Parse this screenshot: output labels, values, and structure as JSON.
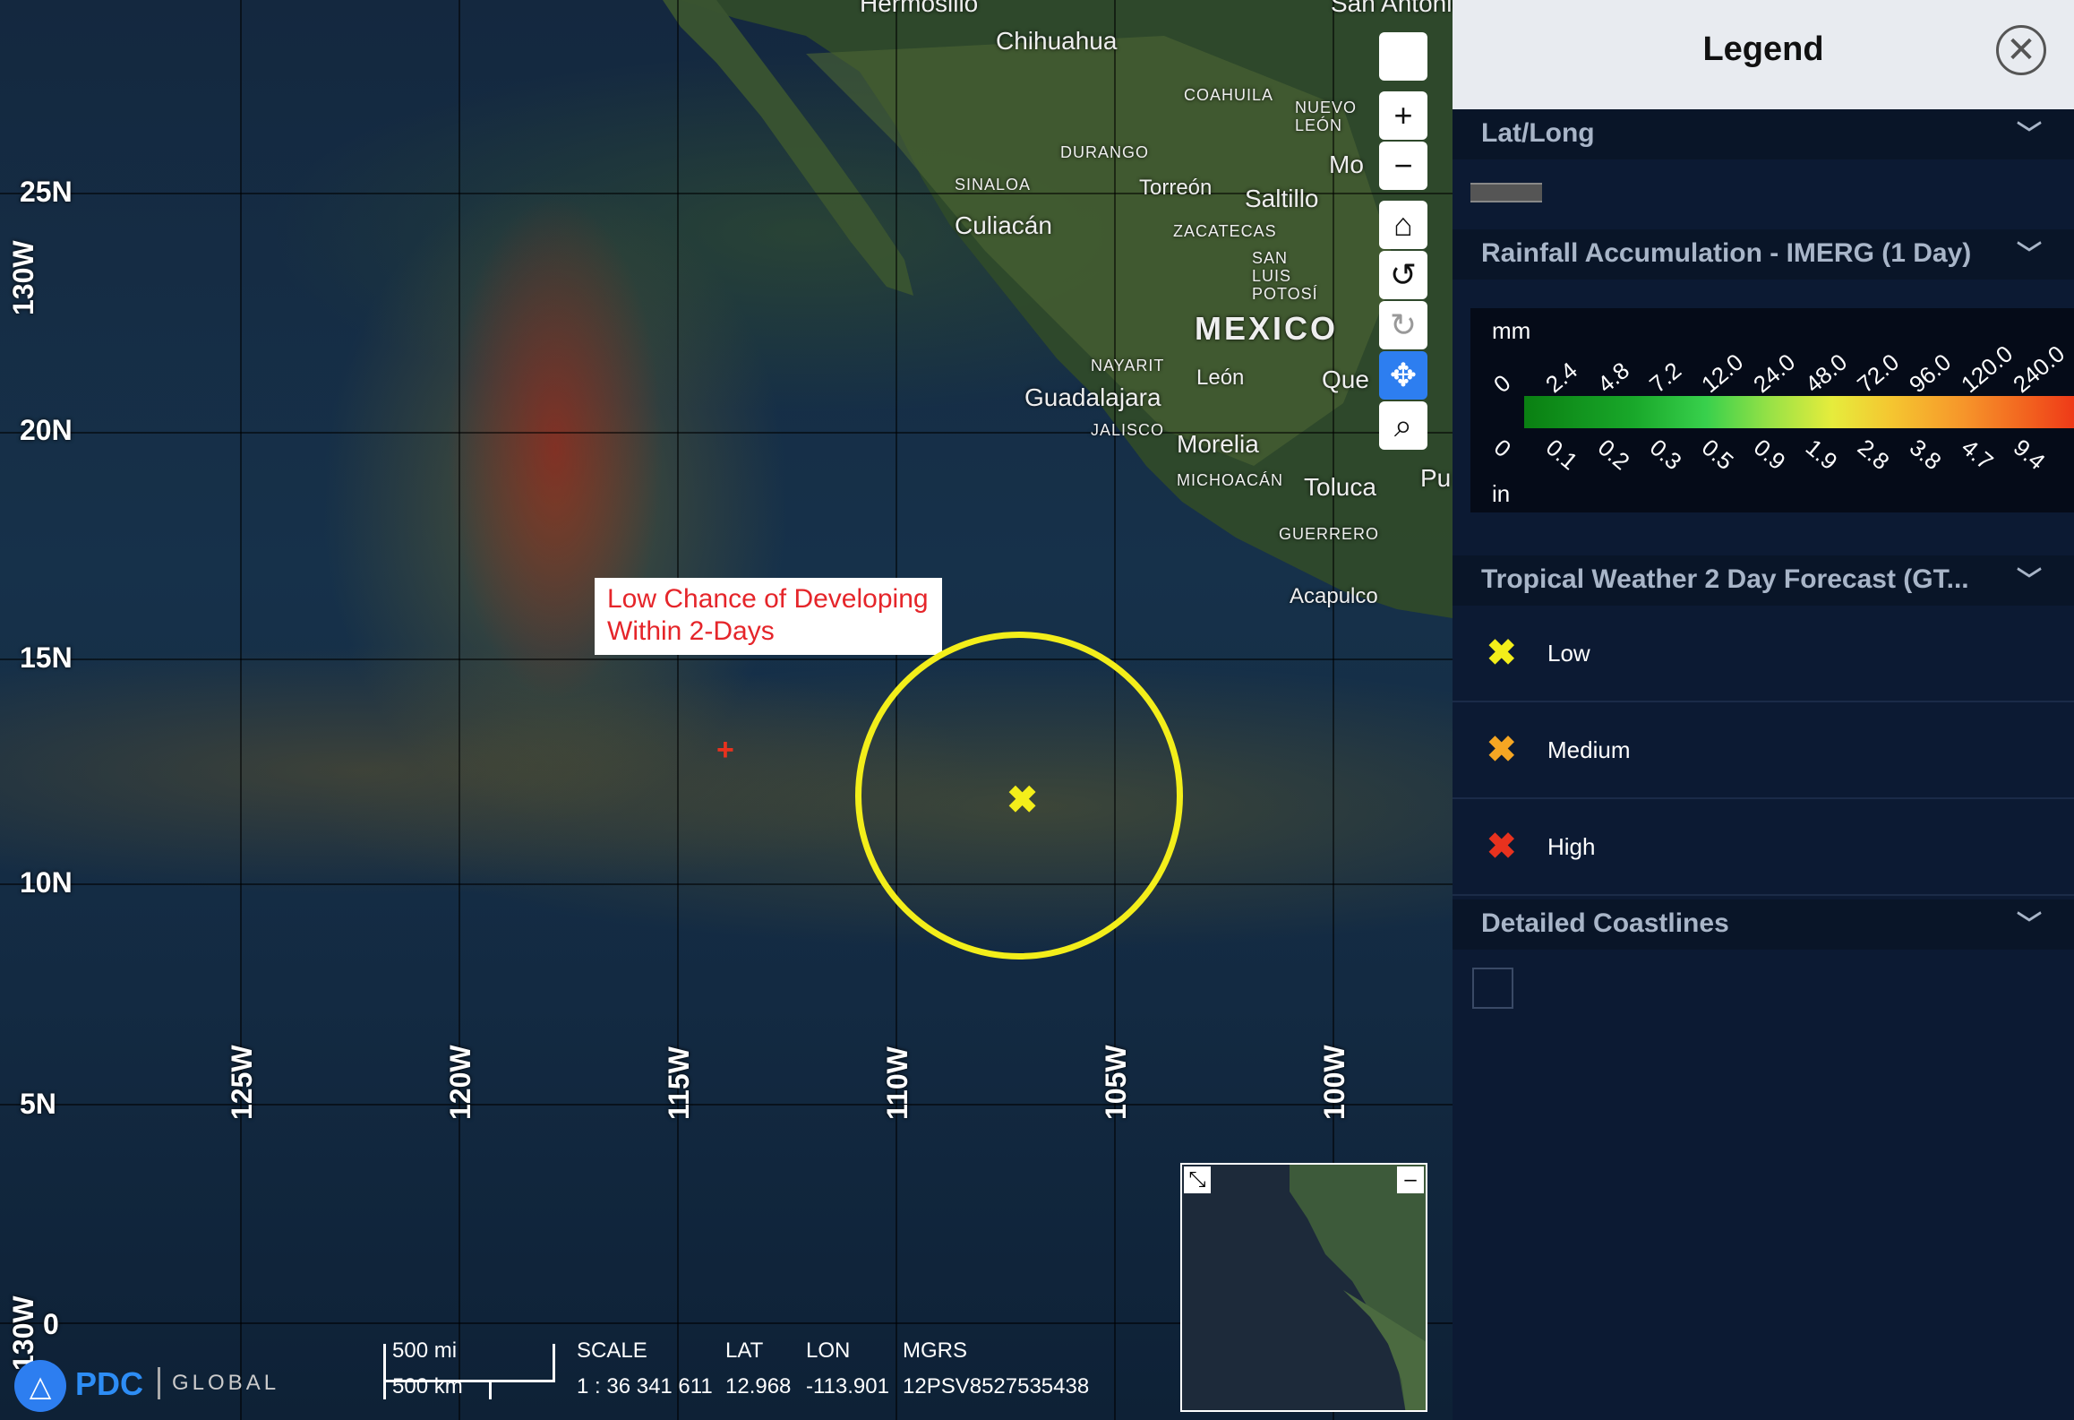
{
  "map": {
    "lat_labels": [
      {
        "label": "25N"
      },
      {
        "label": "20N"
      },
      {
        "label": "15N"
      },
      {
        "label": "10N"
      },
      {
        "label": "5N"
      },
      {
        "label": "0"
      }
    ],
    "lon_labels": [
      {
        "label": "125W"
      },
      {
        "label": "120W"
      },
      {
        "label": "115W"
      },
      {
        "label": "110W"
      },
      {
        "label": "105W"
      },
      {
        "label": "100W"
      }
    ],
    "edge_lon_top": "130W",
    "edge_lon_bottom": "130W",
    "places": {
      "chihuahua": "Chihuahua",
      "coahuila": "COAHUILA",
      "nuevo_leon": "NUEVO LEÓN",
      "durango": "DURANGO",
      "monterrey": "Mo",
      "sinaloa": "SINALOA",
      "torreon": "Torreón",
      "saltillo": "Saltillo",
      "culiacan": "Culiacán",
      "zacatecas": "ZACATECAS",
      "san_luis_potosi": "SAN LUIS POTOSÍ",
      "mexico": "MEXICO",
      "nayarit": "NAYARIT",
      "leon": "León",
      "queretaro": "Que",
      "guadalajara": "Guadalajara",
      "jalisco": "JALISCO",
      "morelia": "Morelia",
      "michoacan": "MICHOACÁN",
      "toluca": "Toluca",
      "puebla": "Pu",
      "guerrero": "GUERRERO",
      "acapulco": "Acapulco",
      "hermosillo": "Hermosillo",
      "san_antonio": "San Antonio"
    },
    "callout": {
      "line1": "Low Chance of Developing",
      "line2": "Within 2-Days"
    },
    "storm_marker_color": "#f3ee1a"
  },
  "toolbar": {
    "buttons": [
      "blank",
      "zoom-in",
      "zoom-out",
      "home",
      "rotate-left",
      "rotate-right",
      "pan",
      "zoom-box"
    ]
  },
  "minimap": {
    "expand_icon": "arrow-expand-icon",
    "collapse_label": "–"
  },
  "footer": {
    "logo": "PDC",
    "logo_sub": "GLOBAL",
    "scale_mi": "500 mi",
    "scale_km": "500 km",
    "scale_label": "SCALE",
    "scale_value": "1 : 36 341 611",
    "lat_label": "LAT",
    "lat_value": "12.968",
    "lon_label": "LON",
    "lon_value": "-113.901",
    "mgrs_label": "MGRS",
    "mgrs_value": "12PSV8527535438"
  },
  "legend": {
    "title": "Legend",
    "sections": {
      "latlong": "Lat/Long",
      "rainfall": "Rainfall Accumulation - IMERG (1 Day)",
      "tropical": "Tropical Weather 2 Day Forecast (GT...",
      "coastlines": "Detailed Coastlines"
    },
    "rainfall": {
      "unit_top": "mm",
      "unit_bottom": "in",
      "mm_ticks": [
        "0",
        "2.4",
        "4.8",
        "7.2",
        "12.0",
        "24.0",
        "48.0",
        "72.0",
        "96.0",
        "120.0",
        "240.0"
      ],
      "in_ticks": [
        "0",
        "0.1",
        "0.2",
        "0.3",
        "0.5",
        "0.9",
        "1.9",
        "2.8",
        "3.8",
        "4.7",
        "9.4"
      ]
    },
    "tropical_items": [
      {
        "label": "Low",
        "color": "#f3ee1a"
      },
      {
        "label": "Medium",
        "color": "#f5a623"
      },
      {
        "label": "High",
        "color": "#e8321e"
      }
    ]
  }
}
